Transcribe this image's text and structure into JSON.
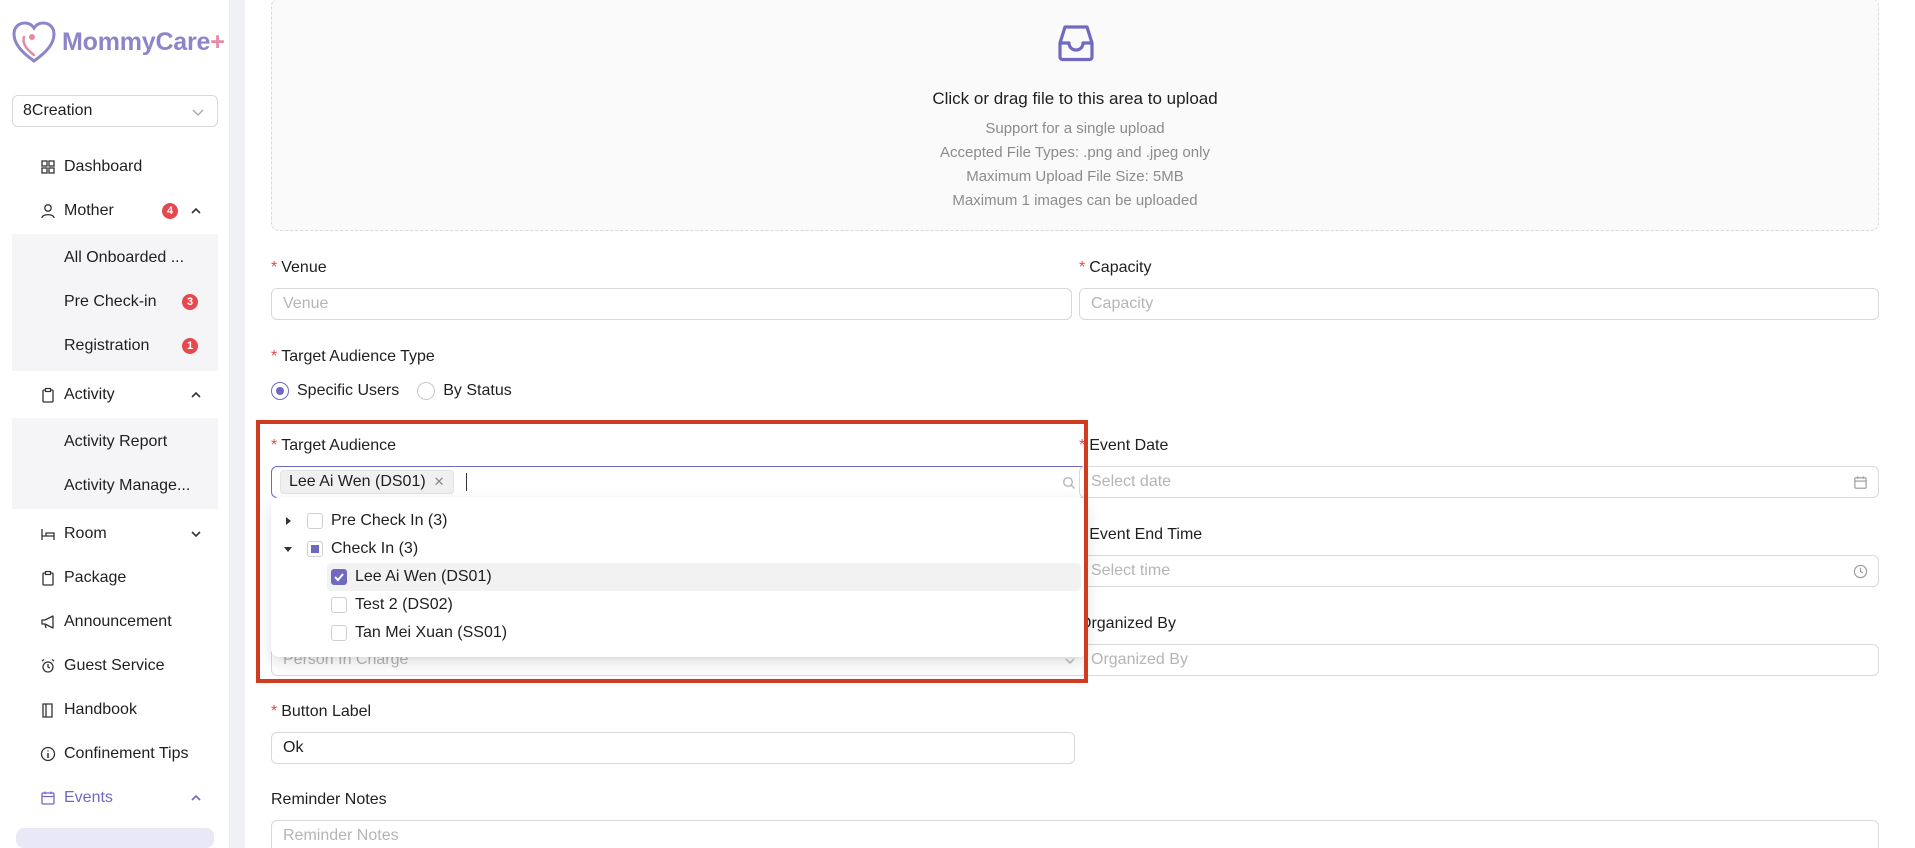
{
  "brand": {
    "name": "MommyCare",
    "plus": "+"
  },
  "org_select": {
    "value": "8Creation"
  },
  "nav": {
    "dashboard": "Dashboard",
    "mother": "Mother",
    "mother_badge": "4",
    "mother_sub": {
      "all_onboarded": "All Onboarded ...",
      "pre_checkin": "Pre Check-in",
      "pre_checkin_badge": "3",
      "registration": "Registration",
      "registration_badge": "1"
    },
    "activity": "Activity",
    "activity_sub": {
      "report": "Activity Report",
      "manage": "Activity Manage..."
    },
    "room": "Room",
    "package": "Package",
    "announcement": "Announcement",
    "guest_service": "Guest Service",
    "handbook": "Handbook",
    "confinement_tips": "Confinement Tips",
    "events": "Events"
  },
  "upload": {
    "title": "Click or drag file to this area to upload",
    "lines": [
      "Support for a single upload",
      "Accepted File Types: .png and .jpeg only",
      "Maximum Upload File Size: 5MB",
      "Maximum 1 images can be uploaded"
    ]
  },
  "form": {
    "venue_label": "Venue",
    "venue_placeholder": "Venue",
    "capacity_label": "Capacity",
    "capacity_placeholder": "Capacity",
    "audience_type_label": "Target Audience Type",
    "audience_type_options": [
      "Specific Users",
      "By Status"
    ],
    "audience_type_selected": "Specific Users",
    "target_audience_label": "Target Audience",
    "target_audience_tag": "Lee Ai Wen (DS01)",
    "event_date_label": "Event Date",
    "event_date_placeholder": "Select date",
    "event_end_time_label": "Event End Time",
    "event_end_time_placeholder": "Select time",
    "organized_by_label": "Organized By",
    "organized_by_placeholder": "Organized By",
    "person_in_charge_placeholder": "Person In Charge",
    "button_label_label": "Button Label",
    "button_label_value": "Ok",
    "reminder_notes_label": "Reminder Notes",
    "reminder_notes_placeholder": "Reminder Notes"
  },
  "tree": {
    "pre_check_in": "Pre Check In (3)",
    "check_in": "Check In (3)",
    "children": [
      "Lee Ai Wen (DS01)",
      "Test 2 (DS02)",
      "Tan Mei Xuan (SS01)"
    ]
  },
  "colors": {
    "accent": "#6f69c2",
    "highlight": "#d23c1e",
    "badge": "#e5484d"
  }
}
